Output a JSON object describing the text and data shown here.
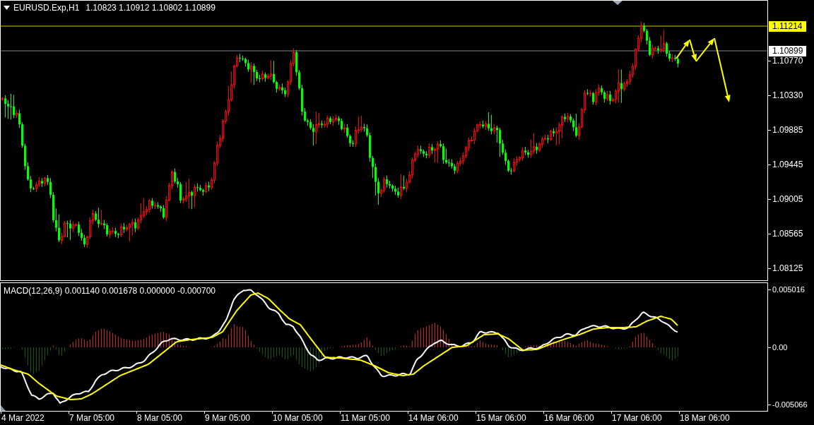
{
  "chart": {
    "symbol": "EURUSD.Exp,H1",
    "ohlc": "1.10823 1.10912 1.10802 1.10899"
  },
  "price_levels": [
    {
      "kind": "drawn",
      "label": "1.11214"
    },
    {
      "kind": "bid",
      "label": "1.10899"
    }
  ],
  "price_axis": [
    "1.10770",
    "1.10330",
    "1.09885",
    "1.09445",
    "1.09005",
    "1.08565",
    "1.08125"
  ],
  "macd": {
    "label": "MACD(12,26,9) 0.001140 0.001678 0.000000 -0.000700",
    "axis": [
      "0.005016",
      "0.00",
      "-0.005066"
    ]
  },
  "time_axis": [
    "4 Mar 2022",
    "7 Mar 05:00",
    "8 Mar 05:00",
    "9 Mar 05:00",
    "10 Mar 05:00",
    "11 Mar 05:00",
    "14 Mar 06:00",
    "15 Mar 06:00",
    "16 Mar 06:00",
    "17 Mar 06:00",
    "18 Mar 06:00"
  ]
}
